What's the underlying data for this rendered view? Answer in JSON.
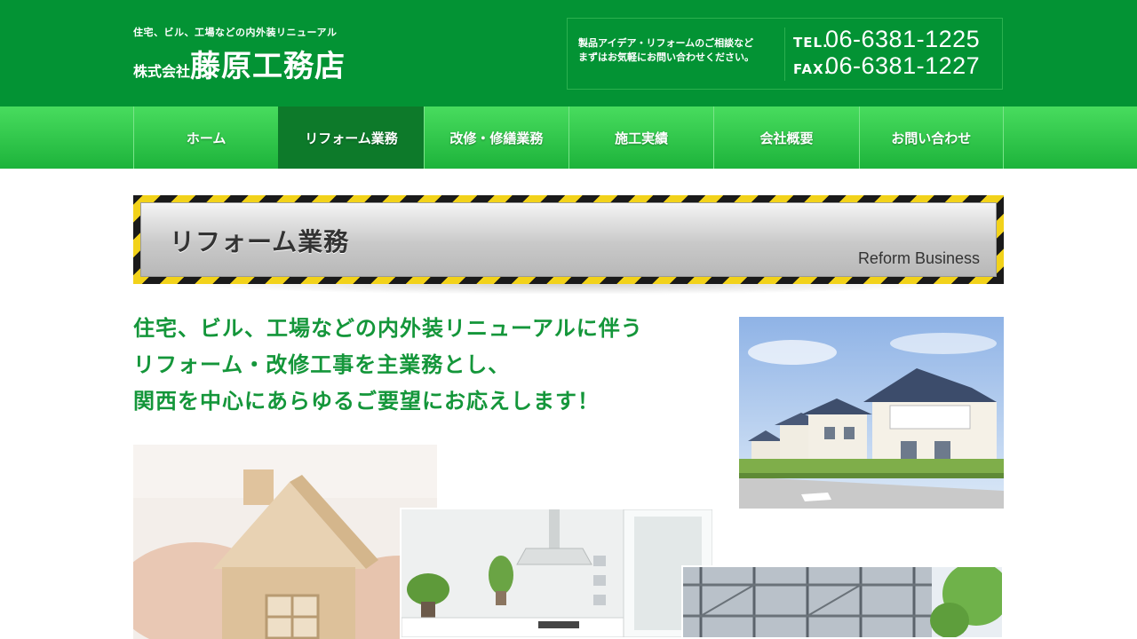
{
  "header": {
    "tagline": "住宅、ビル、工場などの内外装リニューアル",
    "company_prefix": "株式会社",
    "company_name": "藤原工務店",
    "contact_note_line1": "製品アイデア・リフォームのご相談など",
    "contact_note_line2": "まずはお気軽にお問い合わせください。",
    "tel_label": "TEL.",
    "tel": "06-6381-1225",
    "fax_label": "FAX.",
    "fax": "06-6381-1227"
  },
  "nav": {
    "items": [
      {
        "label": "ホーム",
        "active": false
      },
      {
        "label": "リフォーム業務",
        "active": true
      },
      {
        "label": "改修・修繕業務",
        "active": false
      },
      {
        "label": "施工実績",
        "active": false
      },
      {
        "label": "会社概要",
        "active": false
      },
      {
        "label": "お問い合わせ",
        "active": false
      }
    ]
  },
  "banner": {
    "title": "リフォーム業務",
    "subtitle": "Reform Business"
  },
  "lead": {
    "line1": "住宅、ビル、工場などの内外装リニューアルに伴う",
    "line2": "リフォーム・改修工事を主業務とし、",
    "line3": "関西を中心にあらゆるご要望にお応えします！"
  },
  "colors": {
    "header_green": "#039334",
    "nav_green": "#2fc94b",
    "nav_active": "#0d7a2a",
    "lead_green": "#14963a",
    "hazard_yellow": "#f2d21a"
  }
}
